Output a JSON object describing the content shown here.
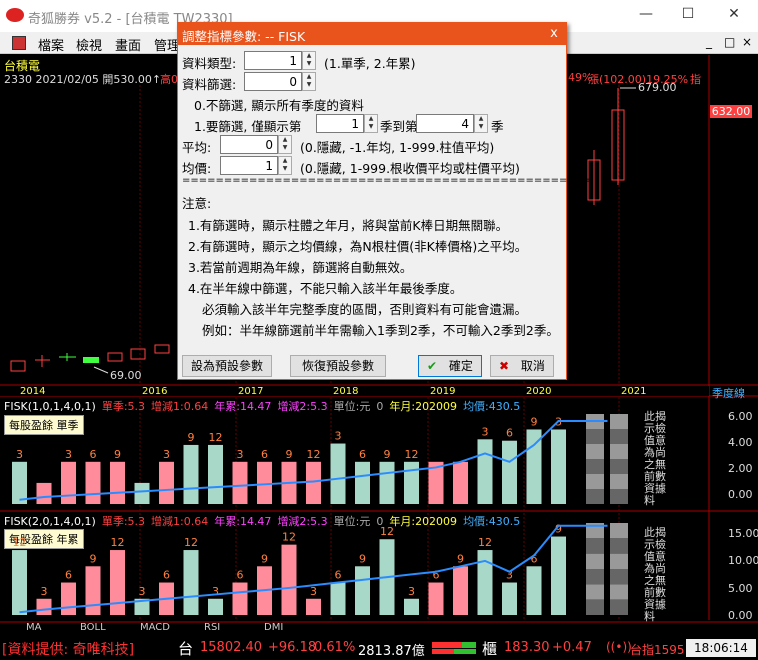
{
  "window": {
    "title": "奇狐勝券 v5.2 - [台積電 TW2330]",
    "min": "—",
    "max": "☐",
    "close": "✕"
  },
  "menu": {
    "items": [
      "檔案",
      "檢視",
      "畫面",
      "管理"
    ],
    "right_buttons": [
      "_",
      "□",
      "×"
    ]
  },
  "stock": {
    "name": "台積電",
    "info": "2330  2021/02/05 開530.00↑",
    "info_high": "高0",
    "change_pct_left": "49%",
    "change": "漲(102.00)19.25%",
    "right_label": "指",
    "high_label": "679.00",
    "last_price": "632.00",
    "low_label": "69.00"
  },
  "years": [
    "2014",
    "2016",
    "2017",
    "2018",
    "2019",
    "2020",
    "2021"
  ],
  "period_label": "季度線",
  "panel1": {
    "header": [
      {
        "text": "FISK(1,0,1,4,0,1)",
        "color": "#ffffff"
      },
      {
        "text": "單季:5.3",
        "color": "#ff4040"
      },
      {
        "text": "增減1:0.64",
        "color": "#ff4040"
      },
      {
        "text": "年累:14.47",
        "color": "#ff40ff"
      },
      {
        "text": "增減2:5.3",
        "color": "#ff40ff"
      },
      {
        "text": "單位:元",
        "color": "#aaaaaa"
      },
      {
        "text": "0",
        "color": "#aaaaaa"
      },
      {
        "text": "年月:202009",
        "color": "#ffff40"
      },
      {
        "text": "均價:430.5",
        "color": "#40b0ff"
      }
    ],
    "tag": "每股盈餘  單季",
    "side_text": "此揭示檢值意為尚之無前數資據料",
    "yticks": [
      "6.00",
      "4.00",
      "2.00",
      "0.00"
    ]
  },
  "panel2": {
    "header": [
      {
        "text": "FISK(2,0,1,4,0,1)",
        "color": "#ffffff"
      },
      {
        "text": "單季:5.3",
        "color": "#ff4040"
      },
      {
        "text": "增減1:0.64",
        "color": "#ff4040"
      },
      {
        "text": "年累:14.47",
        "color": "#ff40ff"
      },
      {
        "text": "增減2:5.3",
        "color": "#ff40ff"
      },
      {
        "text": "單位:元",
        "color": "#aaaaaa"
      },
      {
        "text": "0",
        "color": "#aaaaaa"
      },
      {
        "text": "年月:202009",
        "color": "#ffff40"
      },
      {
        "text": "均價:430.5",
        "color": "#40b0ff"
      }
    ],
    "tag": "每股盈餘  年累",
    "side_text": "此揭示檢值意為尚之無前數資據料",
    "yticks": [
      "15.00",
      "10.00",
      "5.00",
      "0.00"
    ]
  },
  "chart_data": [
    {
      "type": "bar",
      "title": "每股盈餘 單季",
      "ylim": [
        0,
        6.4
      ],
      "values": [
        3.0,
        1.5,
        3.0,
        3.0,
        3.0,
        1.5,
        3.0,
        4.2,
        4.2,
        3.0,
        3.0,
        3.0,
        3.0,
        4.3,
        3.0,
        3.0,
        3.0,
        3.0,
        3.0,
        4.6,
        4.5,
        5.3,
        5.3
      ],
      "labels": [
        "3",
        "",
        "3",
        "6",
        "9",
        "",
        "3",
        "9",
        "12",
        "3",
        "6",
        "9",
        "12",
        "3",
        "6",
        "9",
        "12",
        "",
        "",
        "3",
        "6",
        "9",
        "3"
      ],
      "colors": [
        "g",
        "r",
        "r",
        "r",
        "r",
        "g",
        "r",
        "g",
        "g",
        "r",
        "r",
        "r",
        "r",
        "g",
        "g",
        "g",
        "g",
        "r",
        "r",
        "g",
        "g",
        "g",
        "g"
      ],
      "avg_line": [
        0.3,
        0.5,
        0.6,
        0.7,
        0.8,
        0.9,
        1.0,
        1.1,
        1.2,
        1.3,
        1.4,
        1.5,
        1.6,
        1.8,
        2.0,
        2.2,
        2.4,
        2.6,
        3.0,
        3.6,
        3.0,
        4.2,
        5.9,
        5.9,
        5.9
      ]
    },
    {
      "type": "bar",
      "title": "每股盈餘 年累",
      "ylim": [
        0,
        17
      ],
      "values": [
        12.0,
        3.0,
        6.0,
        9.0,
        12.0,
        3.0,
        6.0,
        12.0,
        3.0,
        6.0,
        9.0,
        13.0,
        3.0,
        6.0,
        9.0,
        14.0,
        3.0,
        6.0,
        9.0,
        12.0,
        6.0,
        9.0,
        14.5
      ],
      "labels": [
        "12",
        "3",
        "6",
        "9",
        "12",
        "3",
        "6",
        "12",
        "3",
        "6",
        "9",
        "12",
        "3",
        "6",
        "9",
        "12",
        "3",
        "6",
        "9",
        "12",
        "3",
        "6",
        "9"
      ],
      "colors": [
        "g",
        "r",
        "r",
        "r",
        "r",
        "g",
        "r",
        "g",
        "g",
        "r",
        "r",
        "r",
        "r",
        "g",
        "g",
        "g",
        "g",
        "r",
        "r",
        "g",
        "g",
        "g",
        "g"
      ],
      "avg_line": [
        0.5,
        1.0,
        1.4,
        1.8,
        2.2,
        2.6,
        3.0,
        3.4,
        3.8,
        4.2,
        4.6,
        5.0,
        5.5,
        6.0,
        6.5,
        7.0,
        7.5,
        8.0,
        9.0,
        10.0,
        8.0,
        11.0,
        16.5,
        16.5,
        16.5
      ]
    }
  ],
  "dialog": {
    "title": "調整指標參數: -- FISK",
    "close": "x",
    "type_label": "資料類型:",
    "type_value": "1",
    "type_hint": "(1.單季, 2.年累)",
    "filter_label": "資料篩選:",
    "filter_value": "0",
    "line0": "0.不篩選, 顯示所有季度的資料",
    "line1_a": "1.要篩選, 僅顯示第",
    "line1_v1": "1",
    "line1_b": "季到第",
    "line1_v2": "4",
    "line1_c": "季",
    "avg_label": "平均:",
    "avg_value": "0",
    "avg_hint": "(0.隱藏, -1.年均, 1-999.柱值平均)",
    "price_label": "均價:",
    "price_value": "1",
    "price_hint": "(0.隱藏, 1-999.根收價平均或柱價平均)",
    "separator": "=================================================",
    "note_title": "注意:",
    "notes": [
      "1.有篩選時，顯示柱體之年月，將與當前K棒日期無關聯。",
      "2.有篩選時，顯示之均價線，為N根柱價(非K棒價格)之平均。",
      "3.若當前週期為年線，篩選將自動無效。",
      "4.在半年線中篩選，不能只輸入該半年最後季度。",
      "必須輸入該半年完整季度的區間，否則資料有可能會遺漏。",
      "例如：半年線篩選前半年需輸入1季到2季，不可輸入2季到2季。"
    ],
    "btn_default": "設為預設參數",
    "btn_restore": "恢復預設參數",
    "btn_ok": "確定",
    "btn_cancel": "取消"
  },
  "tabs": [
    "MA",
    "BOLL",
    "MACD",
    "RSI",
    "DMI"
  ],
  "status": {
    "provider": "[資料提供: 奇唯科技]",
    "tai": "台",
    "index": "15802.40",
    "index_chg": "+96.18",
    "index_pct": "0.61%",
    "volume": "2813.87億",
    "otc": "櫃",
    "otc_val": "183.30",
    "otc_chg": "+0.47",
    "right_name": "台指1595",
    "time": "18:06:14"
  }
}
